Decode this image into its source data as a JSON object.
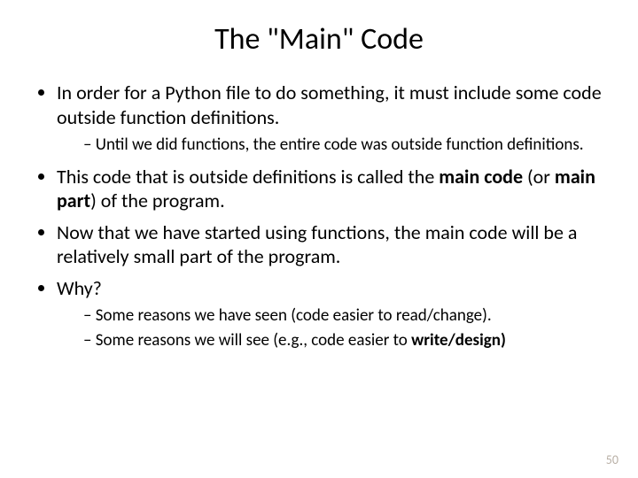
{
  "title": "The \"Main\" Code",
  "bullets": {
    "b0": "In order for a Python file to do something, it must include some code outside function definitions.",
    "b0s0": "Until we did functions, the entire code was outside function definitions.",
    "b1a": "This code that is outside definitions is called the ",
    "b1b": "main code",
    "b1c": " (or ",
    "b1d": "main part",
    "b1e": ") of the program.",
    "b2": "Now that we have started using functions, the main code will be a relatively small part of the program.",
    "b3": "Why?",
    "b3s0": "Some reasons we have seen (code easier to read/change).",
    "b3s1a": "Some reasons we will see (e.g., code easier to ",
    "b3s1b": "write/design)"
  },
  "page_number": "50"
}
